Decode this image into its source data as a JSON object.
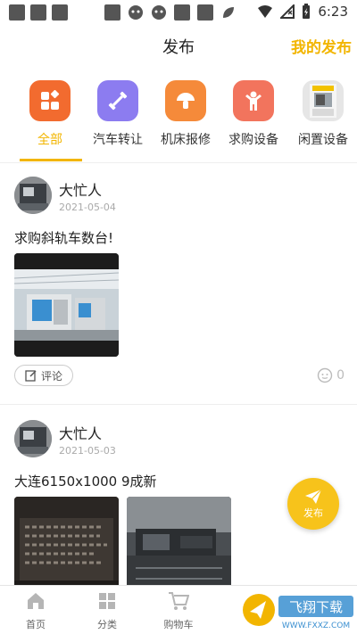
{
  "status_bar": {
    "time": "6:23"
  },
  "header": {
    "title": "发布",
    "my_publish": "我的发布"
  },
  "categories": [
    {
      "label": "全部",
      "icon": "grid-icon",
      "color": "#f26b2f",
      "active": true
    },
    {
      "label": "汽车转让",
      "icon": "dumbbell-icon",
      "color": "#8c7cf0",
      "active": false
    },
    {
      "label": "机床报修",
      "icon": "mushroom-icon",
      "color": "#f58a3a",
      "active": false
    },
    {
      "label": "求购设备",
      "icon": "person-icon",
      "color": "#f2745d",
      "active": false
    },
    {
      "label": "闲置设备",
      "icon": "machine-photo",
      "color": "#e6e6e6",
      "active": false
    }
  ],
  "posts": [
    {
      "username": "大忙人",
      "date": "2021-05-04",
      "text": "求购斜轨车数台!",
      "comment_label": "评论",
      "comment_count": "0"
    },
    {
      "username": "大忙人",
      "date": "2021-05-03",
      "text": "大连6150x1000 9成新"
    }
  ],
  "fab": {
    "label": "发布"
  },
  "bottom_nav": [
    {
      "label": "首页",
      "icon": "home-icon"
    },
    {
      "label": "分类",
      "icon": "category-icon"
    },
    {
      "label": "购物车",
      "icon": "cart-icon"
    }
  ],
  "watermark": {
    "text": "飞翔下载",
    "url": "WWW.FXXZ.COM"
  }
}
